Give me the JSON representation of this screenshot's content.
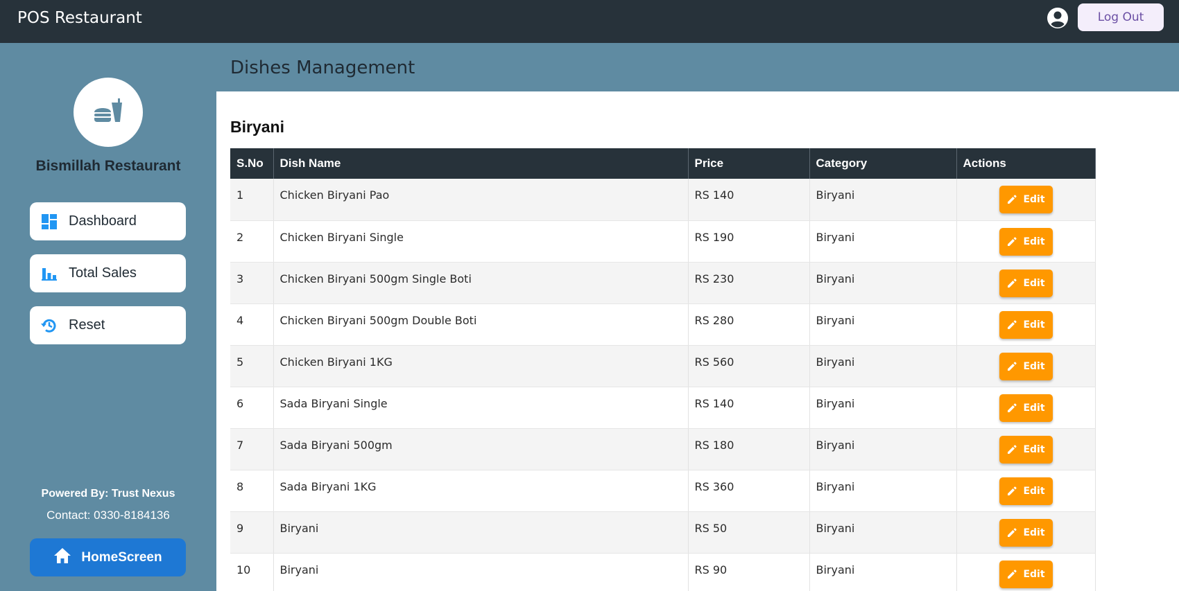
{
  "header": {
    "app_title": "POS Restaurant",
    "logout_label": "Log Out"
  },
  "sidebar": {
    "restaurant_name": "Bismillah Restaurant",
    "items": [
      {
        "label": "Dashboard",
        "icon": "dashboard-icon"
      },
      {
        "label": "Total Sales",
        "icon": "bar-chart-icon"
      },
      {
        "label": "Reset",
        "icon": "reset-icon"
      }
    ],
    "powered_by": "Powered By: Trust Nexus",
    "contact": "Contact: 0330-8184136",
    "home_label": "HomeScreen"
  },
  "main": {
    "page_title": "Dishes Management",
    "section_title": "Biryani",
    "columns": [
      "S.No",
      "Dish Name",
      "Price",
      "Category",
      "Actions"
    ],
    "edit_label": "Edit",
    "rows": [
      {
        "sno": "1",
        "name": "Chicken Biryani Pao",
        "price": "RS 140",
        "category": "Biryani"
      },
      {
        "sno": "2",
        "name": "Chicken Biryani Single",
        "price": "RS 190",
        "category": "Biryani"
      },
      {
        "sno": "3",
        "name": "Chicken Biryani 500gm Single Boti",
        "price": "RS 230",
        "category": "Biryani"
      },
      {
        "sno": "4",
        "name": "Chicken Biryani 500gm Double Boti",
        "price": "RS 280",
        "category": "Biryani"
      },
      {
        "sno": "5",
        "name": "Chicken Biryani 1KG",
        "price": "RS 560",
        "category": "Biryani"
      },
      {
        "sno": "6",
        "name": "Sada Biryani Single",
        "price": "RS 140",
        "category": "Biryani"
      },
      {
        "sno": "7",
        "name": "Sada Biryani 500gm",
        "price": "RS 180",
        "category": "Biryani"
      },
      {
        "sno": "8",
        "name": "Sada Biryani 1KG",
        "price": "RS 360",
        "category": "Biryani"
      },
      {
        "sno": "9",
        "name": "Biryani",
        "price": "RS 50",
        "category": "Biryani"
      },
      {
        "sno": "10",
        "name": "Biryani",
        "price": "RS 90",
        "category": "Biryani"
      }
    ]
  },
  "colors": {
    "topbar": "#27323a",
    "sidebar": "#5f8ba2",
    "accent_blue": "#1e78d4",
    "edit_orange": "#ff9800"
  }
}
